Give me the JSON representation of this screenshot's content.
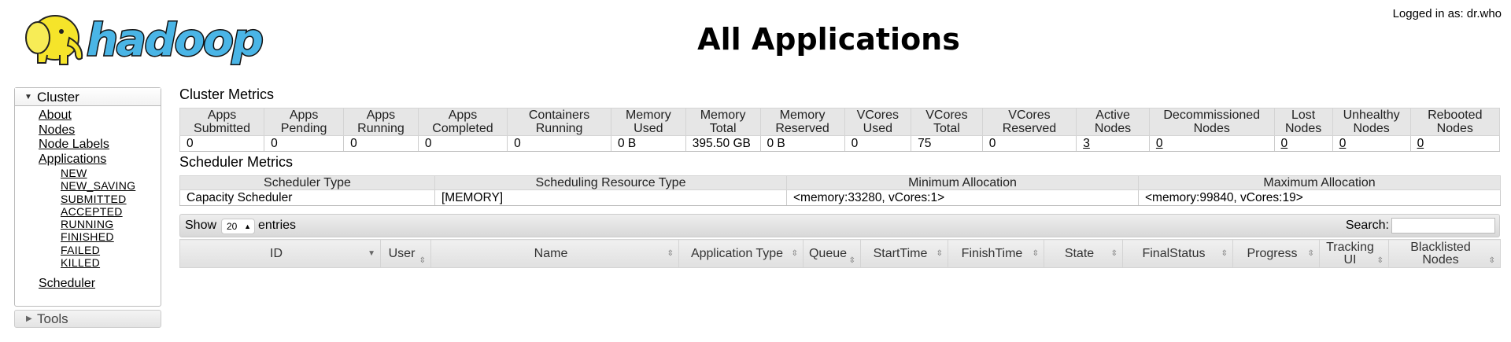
{
  "header": {
    "logo_text": "hadoop",
    "title": "All Applications",
    "login": "Logged in as: dr.who"
  },
  "sidebar": {
    "cluster_label": "Cluster",
    "links": [
      "About",
      "Nodes",
      "Node Labels",
      "Applications"
    ],
    "app_states": [
      "NEW",
      "NEW_SAVING",
      "SUBMITTED",
      "ACCEPTED",
      "RUNNING",
      "FINISHED",
      "FAILED",
      "KILLED"
    ],
    "scheduler_label": "Scheduler",
    "tools_label": "Tools"
  },
  "cluster_metrics": {
    "title": "Cluster Metrics",
    "headers": [
      [
        "Apps",
        "Submitted"
      ],
      [
        "Apps",
        "Pending"
      ],
      [
        "Apps",
        "Running"
      ],
      [
        "Apps",
        "Completed"
      ],
      [
        "Containers",
        "Running"
      ],
      [
        "Memory",
        "Used"
      ],
      [
        "Memory",
        "Total"
      ],
      [
        "Memory",
        "Reserved"
      ],
      [
        "VCores",
        "Used"
      ],
      [
        "VCores",
        "Total"
      ],
      [
        "VCores",
        "Reserved"
      ],
      [
        "Active",
        "Nodes"
      ],
      [
        "Decommissioned",
        "Nodes"
      ],
      [
        "Lost",
        "Nodes"
      ],
      [
        "Unhealthy",
        "Nodes"
      ],
      [
        "Rebooted",
        "Nodes"
      ]
    ],
    "values": [
      "0",
      "0",
      "0",
      "0",
      "0",
      "0 B",
      "395.50 GB",
      "0 B",
      "0",
      "75",
      "0",
      "3",
      "0",
      "0",
      "0",
      "0"
    ]
  },
  "scheduler_metrics": {
    "title": "Scheduler Metrics",
    "headers": [
      "Scheduler Type",
      "Scheduling Resource Type",
      "Minimum Allocation",
      "Maximum Allocation"
    ],
    "values": [
      "Capacity Scheduler",
      "[MEMORY]",
      "<memory:33280, vCores:1>",
      "<memory:99840, vCores:19>"
    ]
  },
  "table_controls": {
    "show_label": "Show",
    "page_size": "20",
    "entries_label": "entries",
    "search_label": "Search:",
    "search_value": ""
  },
  "apps_table": {
    "columns": [
      "ID",
      "User",
      "Name",
      "Application Type",
      "Queue",
      "StartTime",
      "FinishTime",
      "State",
      "FinalStatus",
      "Progress",
      "Tracking UI",
      "Blacklisted Nodes"
    ]
  },
  "colors": {
    "header_bg": "#e6e6e6",
    "logo_yellow": "#f5e42a",
    "logo_blue": "#4ab5e6"
  }
}
